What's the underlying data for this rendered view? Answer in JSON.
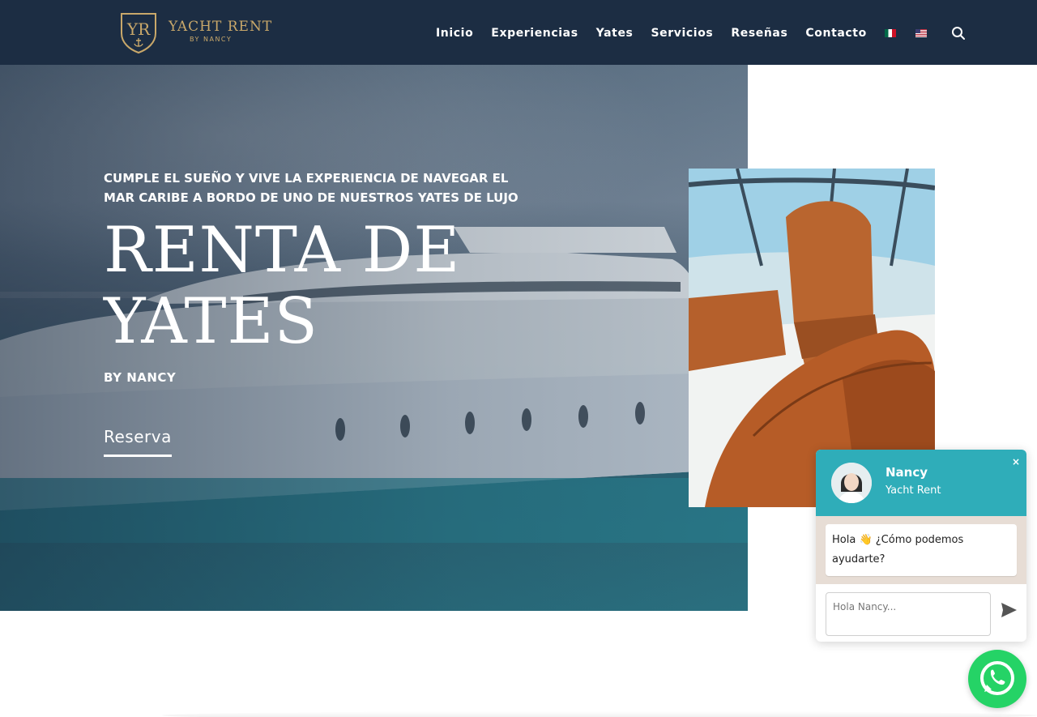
{
  "header": {
    "logo": {
      "monogram": "YR",
      "title": "YACHT RENT",
      "subtitle": "BY NANCY"
    },
    "nav": [
      {
        "label": "Inicio"
      },
      {
        "label": "Experiencias"
      },
      {
        "label": "Yates"
      },
      {
        "label": "Servicios"
      },
      {
        "label": "Reseñas"
      },
      {
        "label": "Contacto"
      }
    ],
    "languages": [
      "mexico-flag-icon",
      "usa-flag-icon"
    ],
    "search_icon": "search-icon"
  },
  "hero": {
    "tagline": "CUMPLE EL SUEÑO Y VIVE LA EXPERIENCIA DE NAVEGAR EL MAR CARIBE A BORDO DE UNO DE NUESTROS YATES DE LUJO",
    "title_line1": "RENTA DE",
    "title_line2": "YATES",
    "byline": "BY NANCY",
    "cta": "Reserva"
  },
  "chat": {
    "agent_name": "Nancy",
    "company": "Yacht Rent",
    "close": "×",
    "greeting": "Hola 👋 ¿Cómo podemos ayudarte?",
    "input_placeholder": "Hola Nancy..."
  },
  "colors": {
    "header_bg": "#1c2d43",
    "gold": "#c9a86a",
    "chat_teal": "#2fadb9",
    "whatsapp_green": "#25d366"
  }
}
